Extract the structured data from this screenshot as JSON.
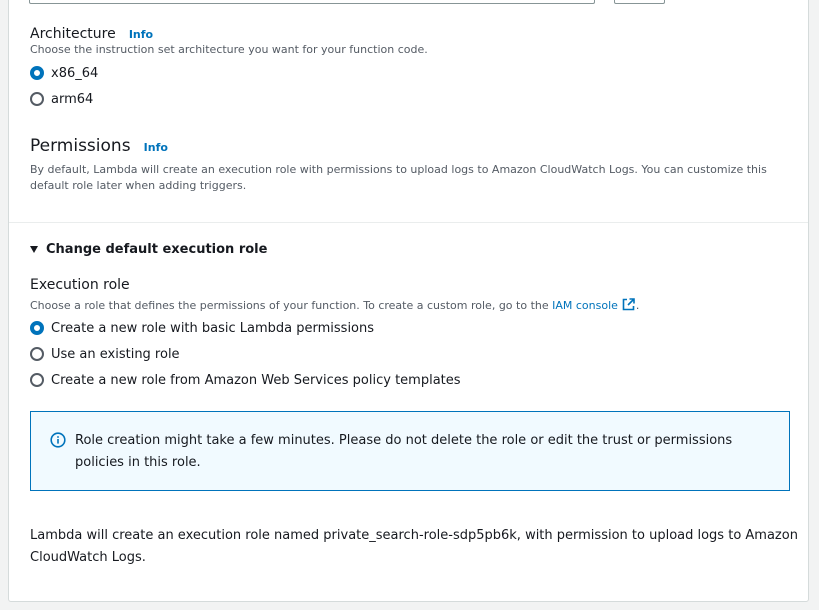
{
  "architecture": {
    "label": "Architecture",
    "info": "Info",
    "description": "Choose the instruction set architecture you want for your function code.",
    "options": [
      {
        "label": "x86_64",
        "checked": true
      },
      {
        "label": "arm64",
        "checked": false
      }
    ]
  },
  "permissions": {
    "heading": "Permissions",
    "info": "Info",
    "description": "By default, Lambda will create an execution role with permissions to upload logs to Amazon CloudWatch Logs. You can customize this default role later when adding triggers."
  },
  "change_role": {
    "toggle_label": "Change default execution role",
    "expanded": true
  },
  "execution_role": {
    "label": "Execution role",
    "description_prefix": "Choose a role that defines the permissions of your function. To create a custom role, go to the ",
    "link_text": "IAM console",
    "description_suffix": ".",
    "options": [
      {
        "label": "Create a new role with basic Lambda permissions",
        "checked": true
      },
      {
        "label": "Use an existing role",
        "checked": false
      },
      {
        "label": "Create a new role from Amazon Web Services policy templates",
        "checked": false
      }
    ]
  },
  "alert": {
    "text": "Role creation might take a few minutes. Please do not delete the role or edit the trust or permissions policies in this role."
  },
  "summary": {
    "text": "Lambda will create an execution role named private_search-role-sdp5pb6k, with permission to upload logs to Amazon CloudWatch Logs."
  },
  "colors": {
    "accent": "#0073bb",
    "alert_bg": "#f1faff",
    "text": "#16191f",
    "secondary_text": "#545b64"
  }
}
